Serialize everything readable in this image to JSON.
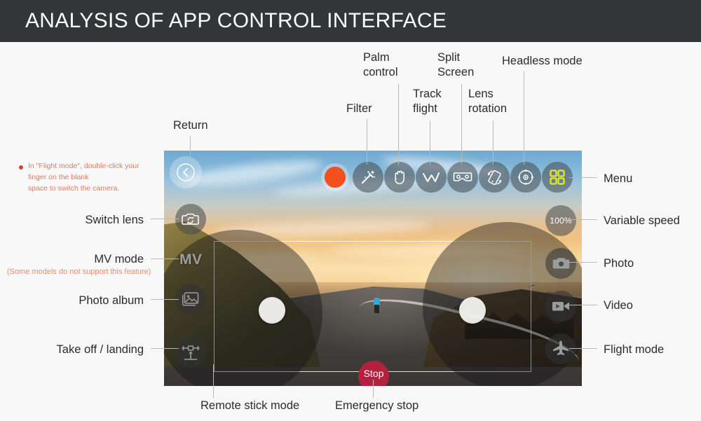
{
  "header": {
    "title": "ANALYSIS OF APP CONTROL INTERFACE"
  },
  "notes": {
    "flight_mode_note": "In \"Flight mode\", double-click your\n  finger on the blank\nspace to switch the camera.",
    "mv_subnote": "(Some models do not support this feature)"
  },
  "callouts": {
    "top": [
      {
        "label": "Filter",
        "icon": "magic-wand-icon"
      },
      {
        "label": "Palm\ncontrol",
        "icon": "hand-icon"
      },
      {
        "label": "Track\nflight",
        "icon": "waveform-icon"
      },
      {
        "label": "Split\nScreen",
        "icon": "vr-goggles-icon"
      },
      {
        "label": "Lens\nrotation",
        "icon": "phone-rotate-icon"
      },
      {
        "label": "Headless mode",
        "icon": "compass-icon"
      },
      {
        "label": "Return",
        "icon": "back-chevron-icon"
      }
    ],
    "left": [
      {
        "label": "Switch lens",
        "icon": "camera-switch-icon"
      },
      {
        "label": "MV mode",
        "icon": "mv-text-icon"
      },
      {
        "label": "Photo album",
        "icon": "photo-album-icon"
      },
      {
        "label": "Take off / landing",
        "icon": "takeoff-landing-icon"
      }
    ],
    "right": [
      {
        "label": "Menu",
        "icon": "grid-menu-icon"
      },
      {
        "label": "Variable speed",
        "icon": "speed-icon"
      },
      {
        "label": "Photo",
        "icon": "camera-icon"
      },
      {
        "label": "Video",
        "icon": "video-camera-icon"
      },
      {
        "label": "Flight mode",
        "icon": "airplane-icon"
      }
    ],
    "bottom": [
      {
        "label": "Remote stick mode",
        "icon": "joystick-icon"
      },
      {
        "label": "Emergency stop",
        "icon": "stop-button-icon"
      }
    ]
  },
  "screen_ui": {
    "record_label": "",
    "mv_label": "MV",
    "speed_value": "100%",
    "stop_label": "Stop"
  },
  "colors": {
    "header_bg": "#333537",
    "page_bg": "#f8f8f8",
    "record_orange": "#f2501f",
    "stop_crimson": "#b3213e",
    "menu_yellow": "#e2e832",
    "note_red": "#e27b62",
    "leader_grey": "#b9b9b9",
    "label_text": "#2b2b2b"
  }
}
